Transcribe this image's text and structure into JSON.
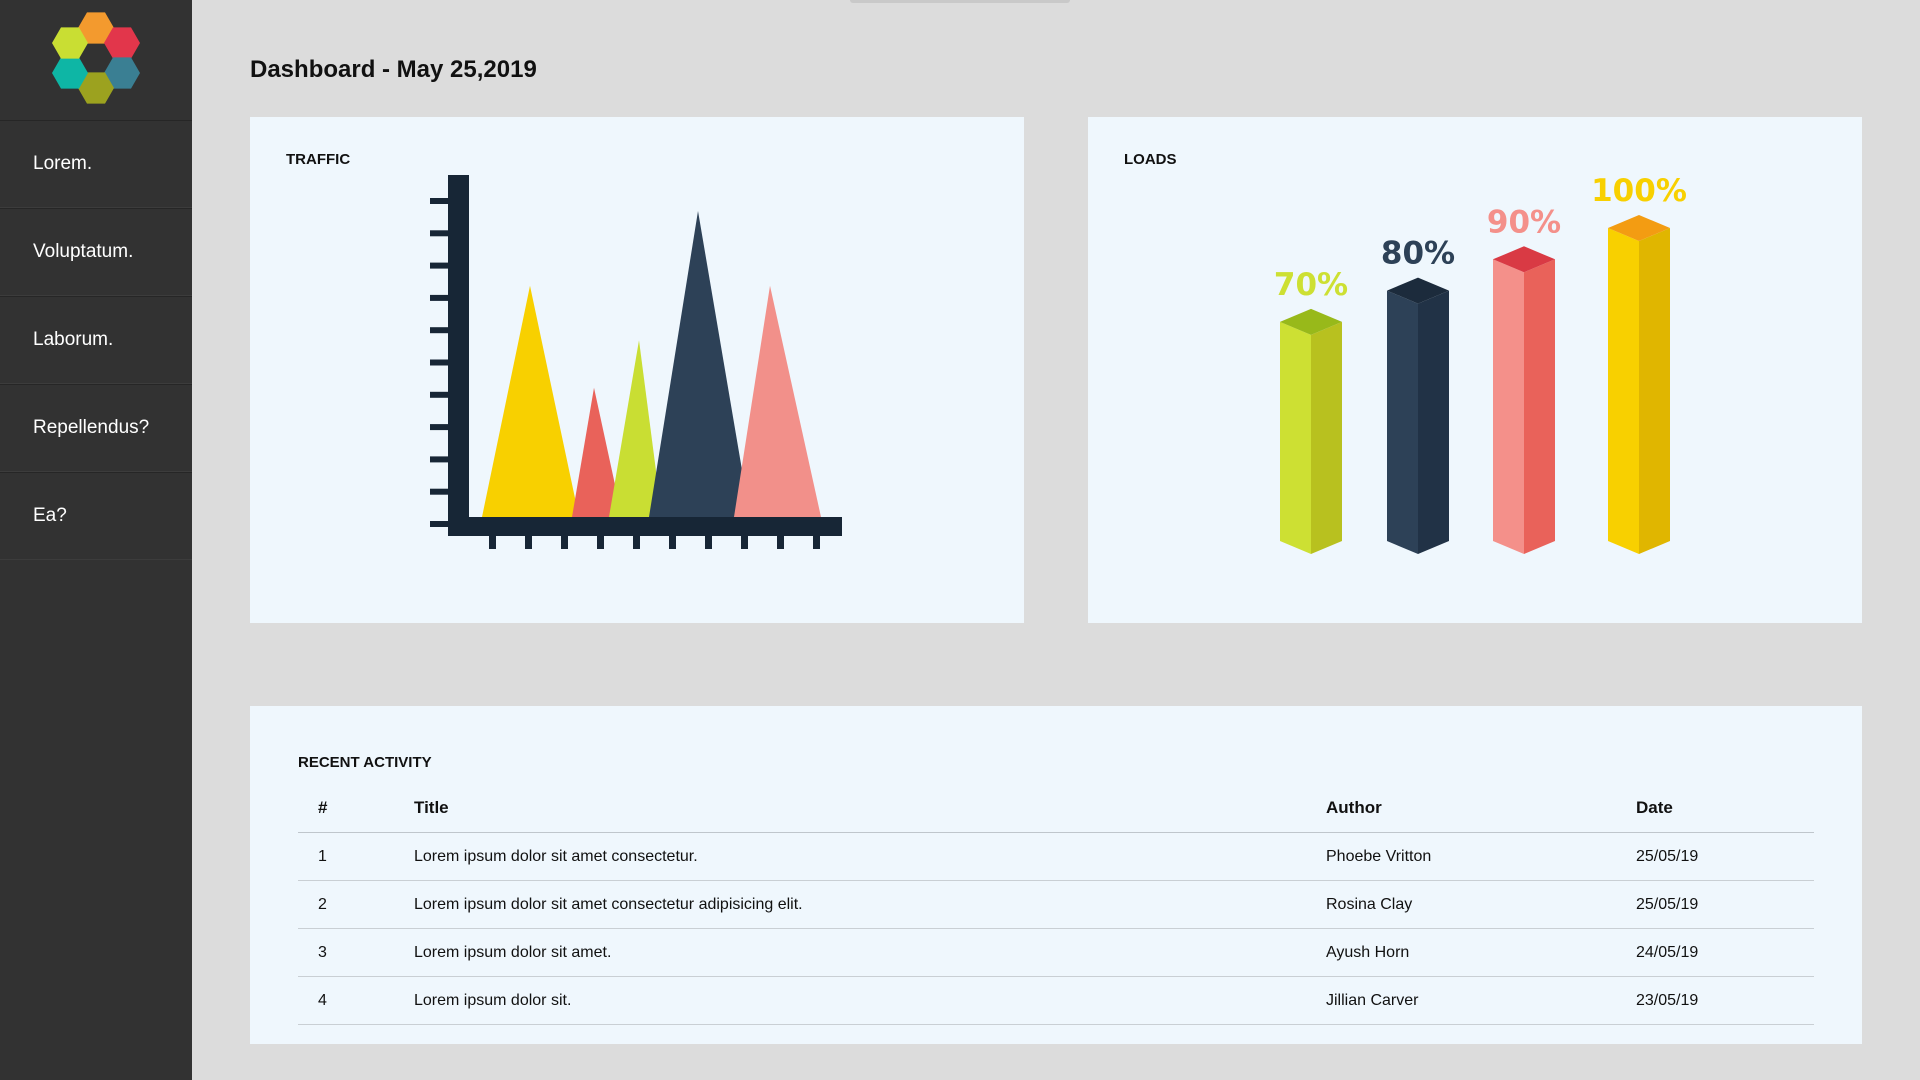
{
  "sidebar": {
    "logo_icon": "hexagon-flower-logo",
    "logo_colors": [
      "#f39a2e",
      "#e2364b",
      "#3a7f93",
      "#9ca21f",
      "#0eb6a5",
      "#c9de33"
    ],
    "items": [
      {
        "label": "Lorem."
      },
      {
        "label": "Voluptatum."
      },
      {
        "label": "Laborum."
      },
      {
        "label": "Repellendus?"
      },
      {
        "label": "Ea?"
      }
    ]
  },
  "header": {
    "title": "Dashboard - May 25,2019"
  },
  "traffic": {
    "title": "TRAFFIC",
    "chart_data": {
      "type": "area",
      "title": "TRAFFIC",
      "xlabel": "",
      "ylabel": "",
      "note": "Illustrative triangle peaks, unlabeled axes",
      "series": [
        {
          "color": "#f8d000",
          "peak": 0.68
        },
        {
          "color": "#e9625a",
          "peak": 0.38
        },
        {
          "color": "#c9de33",
          "peak": 0.52
        },
        {
          "color": "#2d4157",
          "peak": 0.9
        },
        {
          "color": "#f2908a",
          "peak": 0.68
        }
      ]
    }
  },
  "loads": {
    "title": "LOADS",
    "chart_data": {
      "type": "bar",
      "title": "LOADS",
      "categories": [
        "",
        "",
        "",
        ""
      ],
      "values": [
        70,
        80,
        90,
        100
      ],
      "labels": [
        "70%",
        "80%",
        "90%",
        "100%"
      ],
      "colors": [
        {
          "front": "#cde033",
          "side": "#b8c11f",
          "top": "#98b91a",
          "label": "#cde033"
        },
        {
          "front": "#2d4157",
          "side": "#213246",
          "top": "#1c2b3c",
          "label": "#2d4157"
        },
        {
          "front": "#f4908a",
          "side": "#e9625a",
          "top": "#d93a44",
          "label": "#f4908a"
        },
        {
          "front": "#f8d000",
          "side": "#e0b600",
          "top": "#f39c12",
          "label": "#f8d000"
        }
      ]
    }
  },
  "activity": {
    "title": "RECENT ACTIVITY",
    "columns": [
      "#",
      "Title",
      "Author",
      "Date"
    ],
    "rows": [
      {
        "num": "1",
        "title": "Lorem ipsum dolor sit amet consectetur.",
        "author": "Phoebe Vritton",
        "date": "25/05/19"
      },
      {
        "num": "2",
        "title": "Lorem ipsum dolor sit amet consectetur adipisicing elit.",
        "author": "Rosina Clay",
        "date": "25/05/19"
      },
      {
        "num": "3",
        "title": "Lorem ipsum dolor sit amet.",
        "author": "Ayush Horn",
        "date": "24/05/19"
      },
      {
        "num": "4",
        "title": "Lorem ipsum dolor sit.",
        "author": "Jillian Carver",
        "date": "23/05/19"
      }
    ]
  }
}
